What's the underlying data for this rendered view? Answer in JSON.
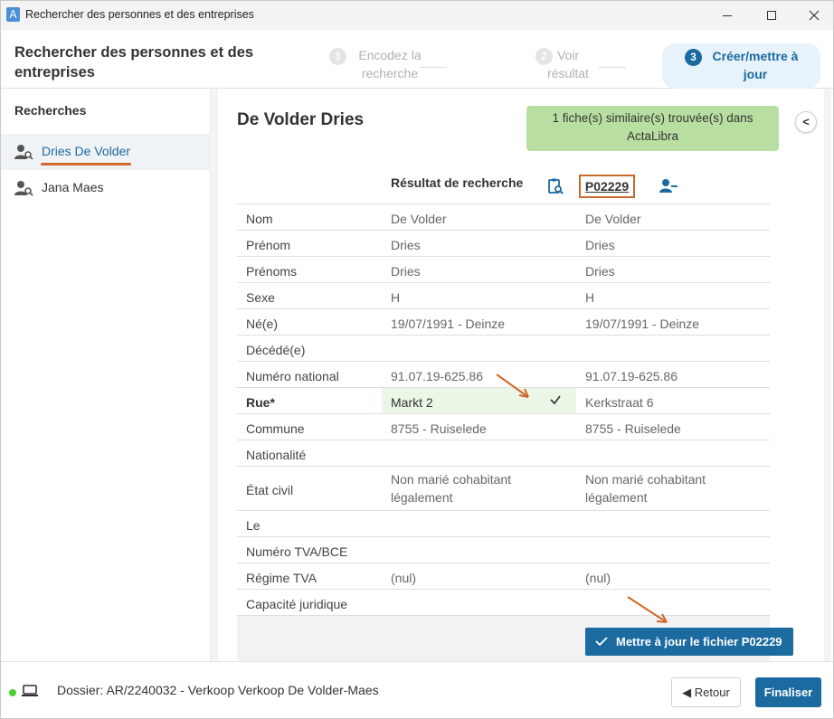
{
  "window": {
    "title": "Rechercher des personnes et des entreprises",
    "app_icon_letter": "A"
  },
  "header": {
    "heading": "Rechercher des personnes et des entreprises",
    "steps": [
      {
        "number": "1",
        "label": "Encodez la recherche",
        "state": "done"
      },
      {
        "number": "2",
        "label": "Voir résultat",
        "state": "done"
      },
      {
        "number": "3",
        "label": "Créer/mettre à jour",
        "state": "active"
      }
    ]
  },
  "sidebar": {
    "title": "Recherches",
    "items": [
      {
        "label": "Dries De Volder",
        "active": true,
        "icon": "person-search-icon"
      },
      {
        "label": "Jana Maes",
        "active": false,
        "icon": "person-search-icon"
      }
    ]
  },
  "main": {
    "record_title": "De Volder Dries",
    "tooltip": "1 fiche(s) similaire(s) trouvée(s) dans ActaLibra",
    "collapse_label": "<",
    "column_header_search": "Résultat de recherche",
    "column_header_record": "P02229",
    "rows": [
      {
        "label": "Nom",
        "search": "De Volder",
        "record": "De Volder"
      },
      {
        "label": "Prénom",
        "search": "Dries",
        "record": "Dries"
      },
      {
        "label": "Prénoms",
        "search": "Dries",
        "record": "Dries"
      },
      {
        "label": "Sexe",
        "search": "H",
        "record": "H"
      },
      {
        "label": "Né(e)",
        "search": "19/07/1991 - Deinze",
        "record": "19/07/1991 - Deinze"
      },
      {
        "label": "Décédé(e)",
        "search": "",
        "record": ""
      },
      {
        "label": "Numéro national",
        "search": "91.07.19-625.86",
        "record": "91.07.19-625.86"
      },
      {
        "label": "Rue*",
        "search": "Markt 2",
        "record": "Kerkstraat 6",
        "selected": true
      },
      {
        "label": "Commune",
        "search": "8755 - Ruiselede",
        "record": "8755 - Ruiselede"
      },
      {
        "label": "Nationalité",
        "search": "",
        "record": ""
      },
      {
        "label": "État civil",
        "search": "Non marié cohabitant légalement",
        "record": "Non marié cohabitant légalement"
      },
      {
        "label": "Le",
        "search": "",
        "record": ""
      },
      {
        "label": "Numéro TVA/BCE",
        "search": "",
        "record": ""
      },
      {
        "label": "Régime TVA",
        "search": "(nul)",
        "record": "(nul)"
      },
      {
        "label": "Capacité juridique",
        "search": "",
        "record": ""
      }
    ],
    "update_button": "Mettre à jour le fichier P02229"
  },
  "bottom": {
    "dossier": "Dossier: AR/2240032 - Verkoop Verkoop De Volder-Maes",
    "back_label": "◀ Retour",
    "finish_label": "Finaliser"
  },
  "colors": {
    "accent": "#1b6aa0",
    "annotation": "#d0692a",
    "tooltip_bg": "#b9dea1",
    "selected_cell_bg": "#eaf6e6",
    "status_dot": "#4cd136"
  }
}
